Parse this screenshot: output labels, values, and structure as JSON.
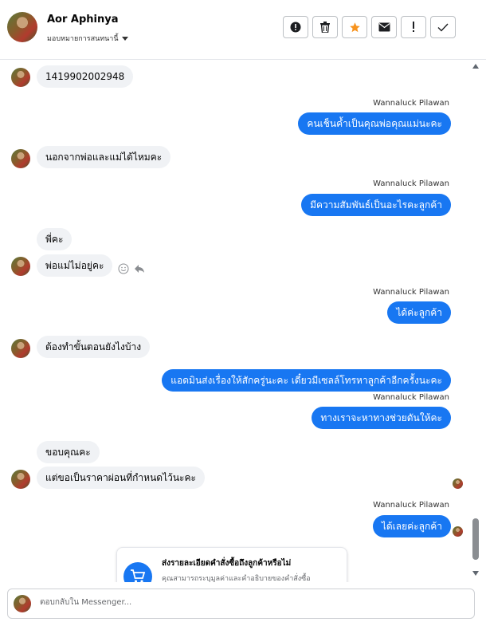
{
  "header": {
    "contact_name": "Aor Aphinya",
    "assign_label": "มอบหมายการสนทนานี้",
    "toolbar_icons": [
      "alert-circle-icon",
      "trash-icon",
      "star-icon",
      "envelope-icon",
      "exclamation-icon",
      "check-icon"
    ],
    "star_color": "#f7931e"
  },
  "messages": {
    "m1": "1419902002948",
    "m2_sender": "Wannaluck Pilawan",
    "m2": "คนเช็นค้ำเป็นคุณพ่อคุณแม่นะคะ",
    "m3": "นอกจากพ่อและแม่ได้ไหมคะ",
    "m4_sender": "Wannaluck Pilawan",
    "m4": "มีความสัมพันธ์เป็นอะไรคะลูกค้า",
    "m5": "พี่คะ",
    "m6": "พ่อแม่ไม่อยู่คะ",
    "m7_sender": "Wannaluck Pilawan",
    "m7": "ได้ค่ะลูกค้า",
    "m8": "ต้องทำขั้นตอนยังไงบ้าง",
    "m9": "แอดมินส่งเรื่องให้สักครู่นะคะ    เดี๋ยวมีเซลล์โทรหาลูกค้าอีกครั้งนะคะ",
    "m10_sender": "Wannaluck Pilawan",
    "m10": "ทางเราจะหาทางช่วยดันให้คะ",
    "m11": "ขอบคุณคะ",
    "m12": "แต่ขอเป็นราคาผ่อนที่กำหนดไว้นะคะ",
    "m13_sender": "Wannaluck Pilawan",
    "m13": "ได้เลยค่ะลูกค้า"
  },
  "order_card": {
    "title": "ส่งรายละเอียดคำสั่งซื้อถึงลูกค้าหรือไม่",
    "subtitle": "คุณสามารถระบุมูลค่าและคำอธิบายของคำสั่งซื้อ",
    "icon": "shopping-cart-icon"
  },
  "composer": {
    "placeholder": "ตอบกลับใน Messenger..."
  },
  "colors": {
    "outgoing_bubble": "#1877f2",
    "incoming_bubble": "#f0f2f5"
  }
}
